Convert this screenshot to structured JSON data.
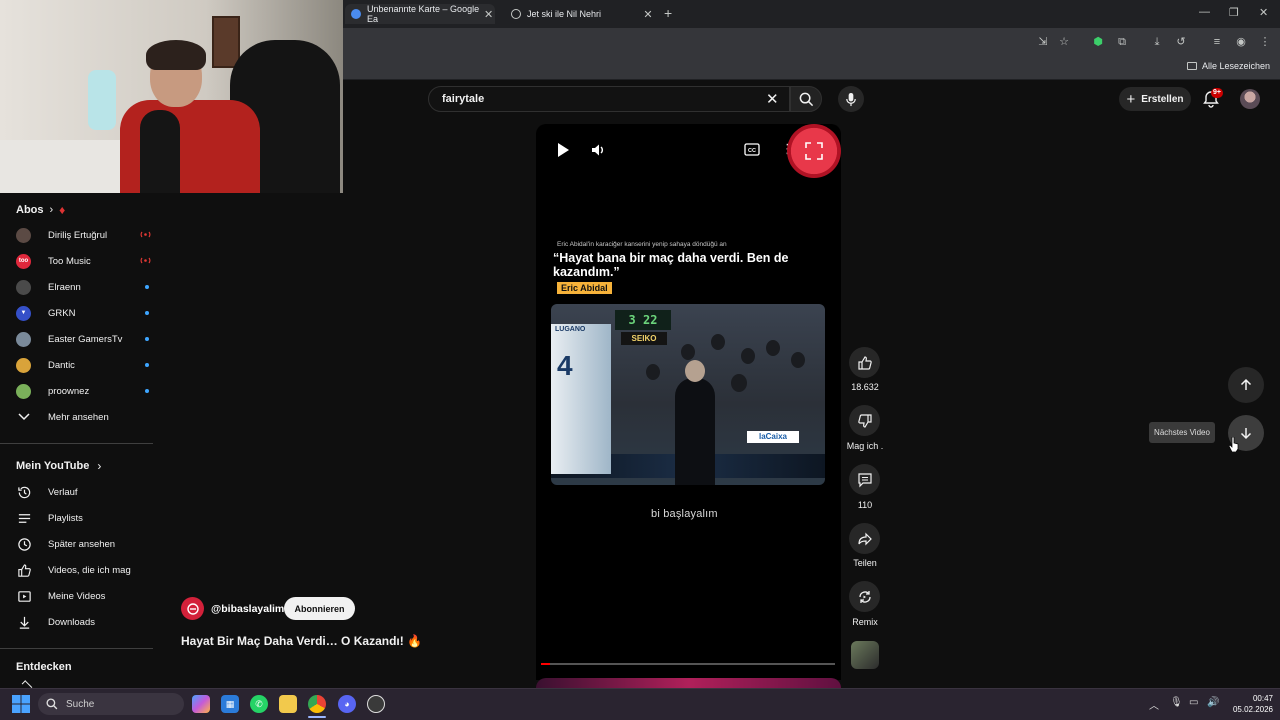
{
  "browser": {
    "tabs": [
      {
        "title": "Unbenannte Karte – Google Ea",
        "active": true
      },
      {
        "title": "Jet ski ile Nil Nehri",
        "active": false
      }
    ],
    "bookmarks_all": "Alle Lesezeichen"
  },
  "header": {
    "search_value": "fairytale",
    "create_label": "Erstellen",
    "notification_badge": "9+"
  },
  "sidebar": {
    "subscriptions_heading": "Abos",
    "channels": [
      {
        "name": "Diriliş Ertuğrul",
        "status": "live",
        "avatar_color": "#5b4a44"
      },
      {
        "name": "Too Music",
        "status": "live",
        "avatar_color": "#e0283c",
        "avatar_text": "too"
      },
      {
        "name": "Elraenn",
        "status": "new",
        "avatar_color": "#4a4a4a"
      },
      {
        "name": "GRKN",
        "status": "new",
        "avatar_color": "#3550c8"
      },
      {
        "name": "Easter GamersTv",
        "status": "new",
        "avatar_color": "#7a8a9a"
      },
      {
        "name": "Dantic",
        "status": "new",
        "avatar_color": "#d9a33a"
      },
      {
        "name": "proownez",
        "status": "new",
        "avatar_color": "#7ab05a"
      }
    ],
    "show_more": "Mehr ansehen",
    "my_youtube_heading": "Mein YouTube",
    "my_items": [
      {
        "label": "Verlauf",
        "icon": "history-icon"
      },
      {
        "label": "Playlists",
        "icon": "playlists-icon"
      },
      {
        "label": "Später ansehen",
        "icon": "watch-later-icon"
      },
      {
        "label": "Videos, die ich mag",
        "icon": "like-icon"
      },
      {
        "label": "Meine Videos",
        "icon": "my-videos-icon"
      },
      {
        "label": "Downloads",
        "icon": "download-icon"
      }
    ],
    "explore_heading": "Entdecken"
  },
  "short": {
    "overlay_small": "Eric Abidal'in karaciğer kanserini yenip sahaya döndüğü an",
    "overlay_quote": "“Hayat bana bir maç daha verdi. Ben de kazandım.”",
    "overlay_name": "Eric Abidal",
    "clip_name": "LUGANO",
    "clip_number": "4",
    "clip_sponsor": "SEIKO",
    "clip_score": "3 22",
    "clip_ad": "laCaixa",
    "watermark": "bi başlayalım",
    "channel_handle": "@bibaslayalim",
    "subscribe_label": "Abonnieren",
    "title": "Hayat Bir Maç Daha Verdi… O Kazandı! 🔥",
    "progress": 0.03
  },
  "actions": {
    "likes": "18.632",
    "dislike_label": "Mag ich .",
    "comments": "110",
    "share_label": "Teilen",
    "remix_label": "Remix"
  },
  "nav": {
    "next_tooltip": "Nächstes Video"
  },
  "taskbar": {
    "search_label": "Suche",
    "time": "00:47",
    "date": "05.02.2026"
  }
}
